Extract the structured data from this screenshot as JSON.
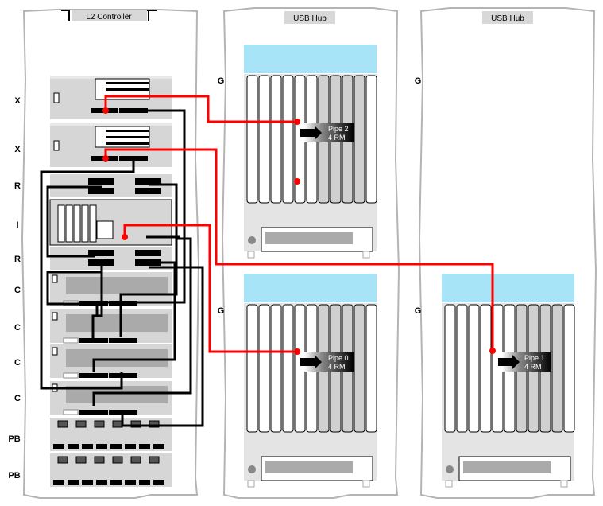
{
  "diagram": {
    "racks": [
      {
        "id": "compute-rack",
        "title": "L2 Controller"
      },
      {
        "id": "graphics-rack-1",
        "title": "USB Hub"
      },
      {
        "id": "graphics-rack-2",
        "title": "USB Hub"
      }
    ],
    "compute_rack_slots": [
      {
        "label": "X",
        "type": "xbrick"
      },
      {
        "label": "X",
        "type": "xbrick"
      },
      {
        "label": "R",
        "type": "router"
      },
      {
        "label": "I",
        "type": "ibrick"
      },
      {
        "label": "R",
        "type": "router"
      },
      {
        "label": "C",
        "type": "cbrick"
      },
      {
        "label": "C",
        "type": "cbrick"
      },
      {
        "label": "C",
        "type": "cbrick"
      },
      {
        "label": "C",
        "type": "cbrick"
      },
      {
        "label": "PB",
        "type": "power-bay"
      },
      {
        "label": "PB",
        "type": "power-bay"
      }
    ],
    "graphics_labels": [
      {
        "rack": 1,
        "label": "G"
      },
      {
        "rack": 1,
        "label": "G"
      },
      {
        "rack": 2,
        "label": "G"
      },
      {
        "rack": 2,
        "label": "G"
      }
    ],
    "pipes": [
      {
        "name": "Pipe 2",
        "rm": "4 RM",
        "location": "graphics-rack-1-top"
      },
      {
        "name": "Pipe 0",
        "rm": "4 RM",
        "location": "graphics-rack-1-bottom"
      },
      {
        "name": "Pipe 1",
        "rm": "4 RM",
        "location": "graphics-rack-2-bottom"
      }
    ],
    "colors": {
      "rack_outline": "#b4b4b4",
      "title_bg": "#d8d8d8",
      "brick_bg": "#d6d6d6",
      "graphics_top": "#a8e4f8",
      "cable_black": "#000000",
      "cable_red": "#ff0000"
    }
  }
}
